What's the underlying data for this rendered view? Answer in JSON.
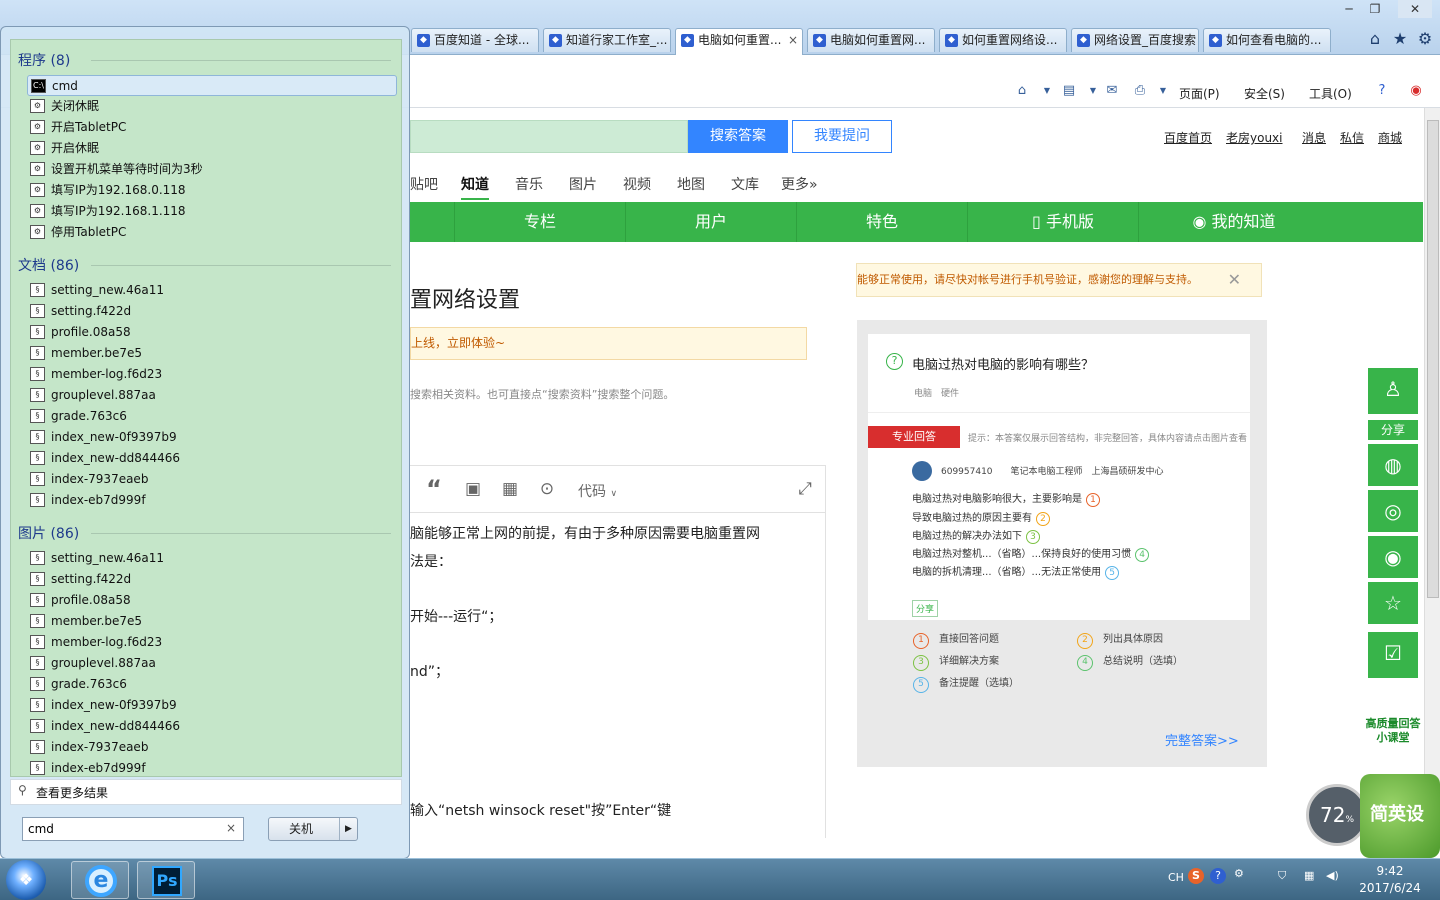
{
  "browser": {
    "tabs": [
      "百度知道 - 全球...",
      "知道行家工作室_...",
      "电脑如何重置...",
      "电脑如何重置网...",
      "如何重置网络设...",
      "网络设置_百度搜索",
      "如何查看电脑的..."
    ],
    "active_tab": 2,
    "tab_close": "×",
    "command_bar": {
      "page": "页面(P)",
      "safety": "安全(S)",
      "tools": "工具(O)"
    }
  },
  "page": {
    "search_button": "搜索答案",
    "ask_button": "我要提问",
    "top_links": [
      "百度首页",
      "老房youxi",
      "消息",
      "私信",
      "商城"
    ],
    "channels": [
      "贴吧",
      "知道",
      "音乐",
      "图片",
      "视频",
      "地图",
      "文库",
      "更多»"
    ],
    "active_channel": "知道",
    "green_nav": [
      "专栏",
      "用户",
      "特色",
      "手机版",
      "我的知道"
    ],
    "question_title": "置网络设置",
    "yellow_tip": "上线，立即体验~",
    "search_hint": "搜索相关资料。也可直接点“搜索资料”搜索整个问题。",
    "editor_code_label": "代码",
    "answer_lines": [
      "脑能够正常上网的前提，有由于多种原因需要电脑重置网",
      "法是：",
      "开始---运行“；",
      "nd”；",
      "输入“netsh winsock reset\"按”Enter“键"
    ],
    "verify_tip": "能够正常使用，请尽快对帐号进行手机号验证，感谢您的理解与支持。",
    "promo": {
      "question": "电脑过热对电脑的影响有哪些？",
      "tags": "电脑　硬件",
      "pro_badge": "专业回答",
      "pro_hint": "提示：本答案仅展示回答结构，非完整回答，具体内容请点击图片查看",
      "user": "609957410　　笔记本电脑工程师　上海昌硕研发中心",
      "lines": [
        "电脑过热对电脑影响很大，主要影响是",
        "导致电脑过热的原因主要有",
        "电脑过热的解决办法如下",
        "电脑过热对整机...（省略）...保持良好的使用习惯",
        "电脑的拆机清理...（省略）...无法正常使用"
      ],
      "share": "分享",
      "legend": [
        "直接回答问题",
        "列出具体原因",
        "详细解决方案",
        "总结说明（选填）",
        "备注提醒（选填）"
      ],
      "full_answer": "完整答案>>"
    },
    "share_label": "分享",
    "hq_label": "高质量回答小课堂",
    "gauge_value": "72",
    "gauge_unit": "%",
    "widget_text": "简英设"
  },
  "start_menu": {
    "groups": [
      {
        "title": "程序 (8)",
        "items": [
          "cmd",
          "关闭休眠",
          "开启TabletPC",
          "开启休眠",
          "设置开机菜单等待时间为3秒",
          "填写IP为192.168.0.118",
          "填写IP为192.168.1.118",
          "停用TabletPC"
        ]
      },
      {
        "title": "文档 (86)",
        "items": [
          "setting_new.46a11",
          "setting.f422d",
          "profile.08a58",
          "member.be7e5",
          "member-log.f6d23",
          "grouplevel.887aa",
          "grade.763c6",
          "index_new-0f9397b9",
          "index_new-dd844466",
          "index-7937eaeb",
          "index-eb7d999f"
        ]
      },
      {
        "title": "图片 (86)",
        "items": [
          "setting_new.46a11",
          "setting.f422d",
          "profile.08a58",
          "member.be7e5",
          "member-log.f6d23",
          "grouplevel.887aa",
          "grade.763c6",
          "index_new-0f9397b9",
          "index_new-dd844466",
          "index-7937eaeb",
          "index-eb7d999f"
        ]
      }
    ],
    "see_more": "查看更多结果",
    "search_value": "cmd",
    "search_clear": "×",
    "shutdown": "关机"
  },
  "taskbar": {
    "lang": "CH",
    "time": "9:42",
    "date": "2017/6/24"
  }
}
